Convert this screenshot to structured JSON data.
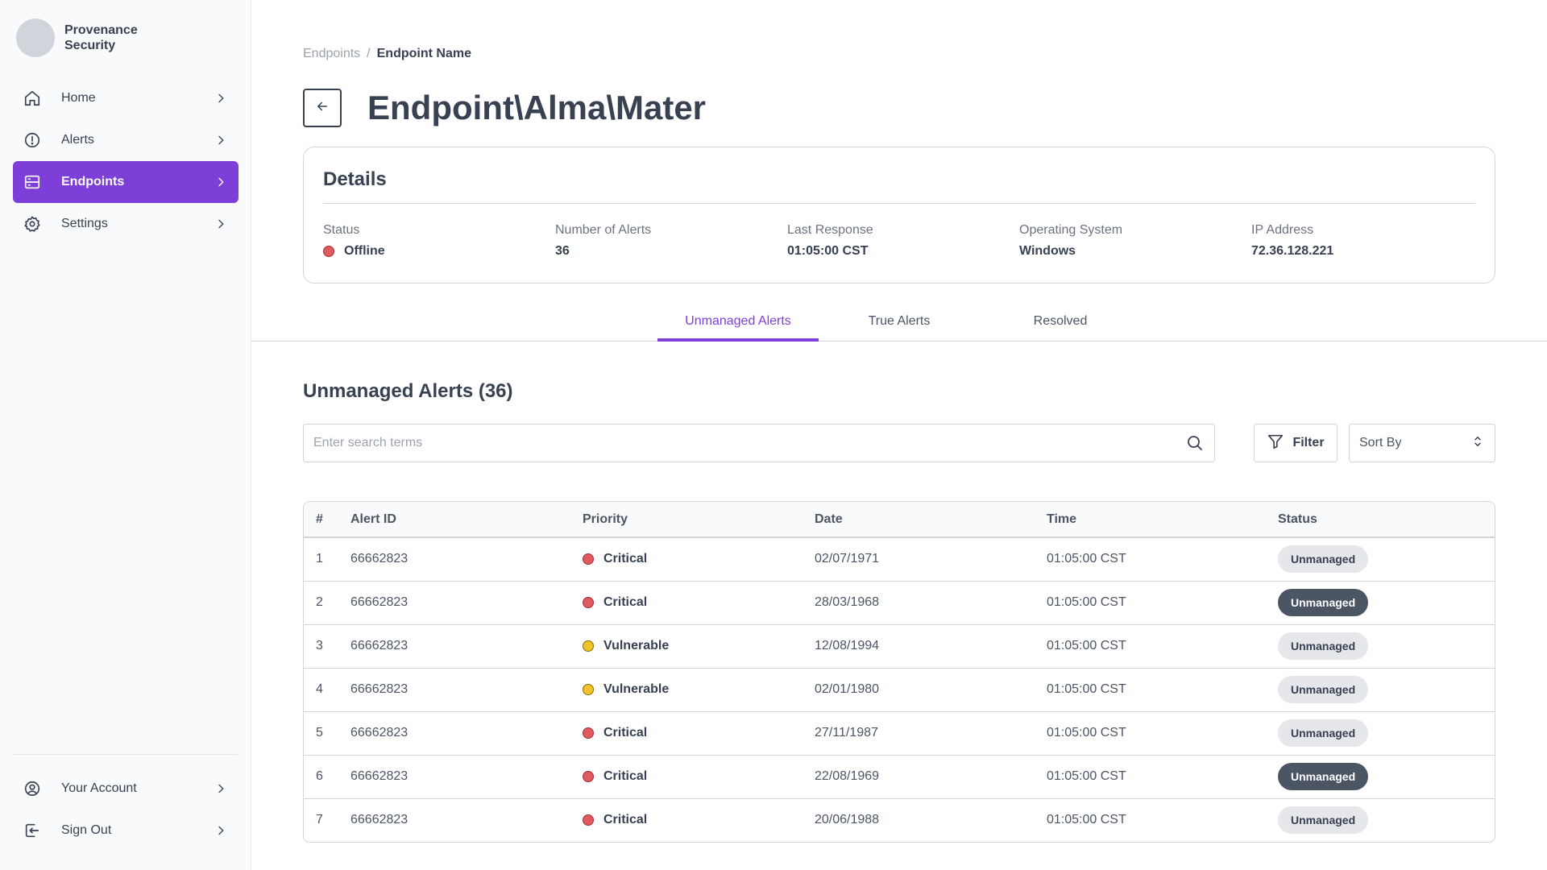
{
  "brand": {
    "name": "Provenance Security"
  },
  "sidebar": {
    "items": [
      {
        "label": "Home",
        "icon": "home-icon"
      },
      {
        "label": "Alerts",
        "icon": "alert-circle-icon"
      },
      {
        "label": "Endpoints",
        "icon": "server-icon",
        "active": true
      },
      {
        "label": "Settings",
        "icon": "gear-icon"
      }
    ],
    "bottom_items": [
      {
        "label": "Your Account",
        "icon": "user-circle-icon"
      },
      {
        "label": "Sign Out",
        "icon": "sign-out-icon"
      }
    ]
  },
  "breadcrumb": {
    "parent": "Endpoints",
    "separator": "/",
    "current": "Endpoint Name"
  },
  "page": {
    "title": "Endpoint\\Alma\\Mater"
  },
  "details": {
    "title": "Details",
    "status_label": "Status",
    "status_value": "Offline",
    "alerts_label": "Number of Alerts",
    "alerts_value": "36",
    "response_label": "Last Response",
    "response_value": "01:05:00 CST",
    "os_label": "Operating System",
    "os_value": "Windows",
    "ip_label": "IP Address",
    "ip_value": "72.36.128.221"
  },
  "tabs": [
    {
      "label": "Unmanaged Alerts",
      "active": true
    },
    {
      "label": "True Alerts",
      "active": false
    },
    {
      "label": "Resolved",
      "active": false
    }
  ],
  "section": {
    "title": "Unmanaged Alerts (36)"
  },
  "search": {
    "placeholder": "Enter search terms",
    "value": ""
  },
  "filter": {
    "label": "Filter"
  },
  "sort": {
    "label": "Sort By"
  },
  "table": {
    "headers": {
      "num": "#",
      "id": "Alert ID",
      "priority": "Priority",
      "date": "Date",
      "time": "Time",
      "status": "Status"
    },
    "rows": [
      {
        "num": "1",
        "id": "66662823",
        "priority": "Critical",
        "date": "02/07/1971",
        "time": "01:05:00 CST",
        "status": "Unmanaged",
        "status_style": "light"
      },
      {
        "num": "2",
        "id": "66662823",
        "priority": "Critical",
        "date": "28/03/1968",
        "time": "01:05:00 CST",
        "status": "Unmanaged",
        "status_style": "dark"
      },
      {
        "num": "3",
        "id": "66662823",
        "priority": "Vulnerable",
        "date": "12/08/1994",
        "time": "01:05:00 CST",
        "status": "Unmanaged",
        "status_style": "light"
      },
      {
        "num": "4",
        "id": "66662823",
        "priority": "Vulnerable",
        "date": "02/01/1980",
        "time": "01:05:00 CST",
        "status": "Unmanaged",
        "status_style": "light"
      },
      {
        "num": "5",
        "id": "66662823",
        "priority": "Critical",
        "date": "27/11/1987",
        "time": "01:05:00 CST",
        "status": "Unmanaged",
        "status_style": "light"
      },
      {
        "num": "6",
        "id": "66662823",
        "priority": "Critical",
        "date": "22/08/1969",
        "time": "01:05:00 CST",
        "status": "Unmanaged",
        "status_style": "dark"
      },
      {
        "num": "7",
        "id": "66662823",
        "priority": "Critical",
        "date": "20/06/1988",
        "time": "01:05:00 CST",
        "status": "Unmanaged",
        "status_style": "light"
      }
    ]
  },
  "colors": {
    "accent": "#7e3fd9",
    "critical": "#e05a5f",
    "vulnerable": "#f2c229",
    "text": "#374151"
  }
}
